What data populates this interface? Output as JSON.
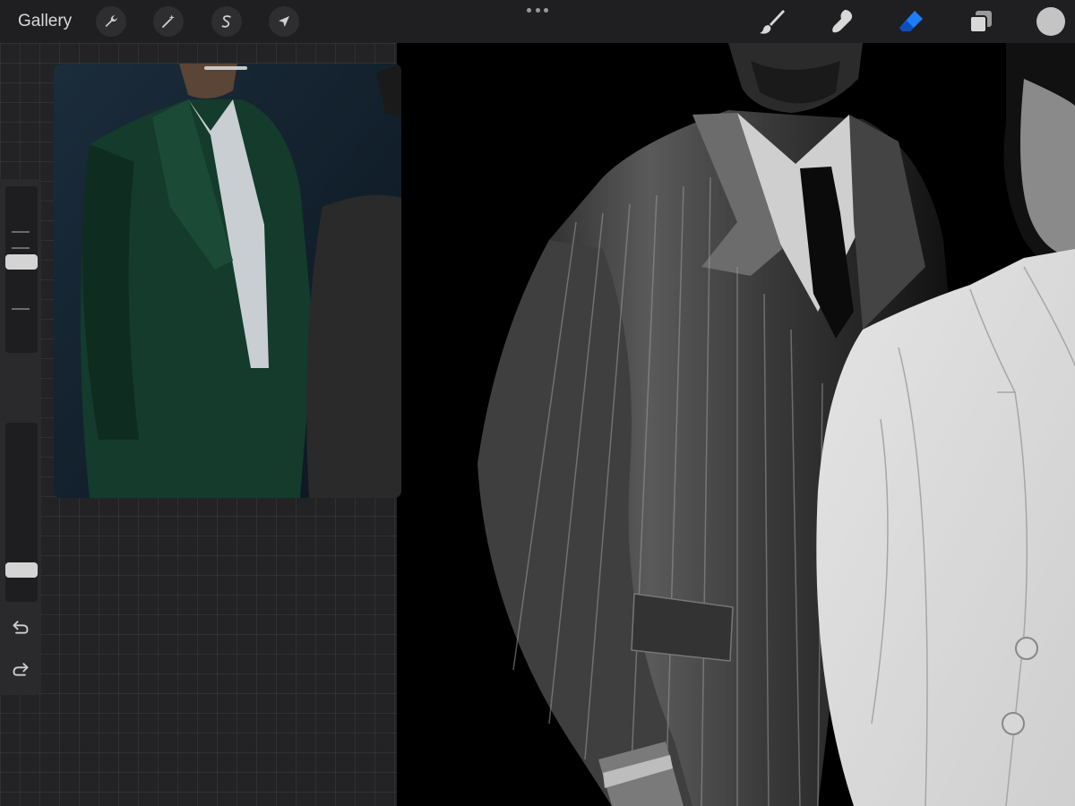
{
  "toolbar": {
    "gallery_label": "Gallery",
    "left_tools": [
      {
        "icon": "wrench-icon",
        "name": "actions-button"
      },
      {
        "icon": "magic-wand-icon",
        "name": "adjustments-button"
      },
      {
        "icon": "selection-s-icon",
        "name": "selection-button"
      },
      {
        "icon": "arrow-cursor-icon",
        "name": "transform-button"
      }
    ],
    "right_tools": [
      {
        "icon": "paintbrush-icon",
        "name": "brush-button"
      },
      {
        "icon": "smudge-icon",
        "name": "smudge-button"
      },
      {
        "icon": "eraser-icon",
        "name": "eraser-button",
        "active": true
      },
      {
        "icon": "layers-icon",
        "name": "layers-button"
      }
    ],
    "active_color": "#c4c4c4",
    "accent_color": "#1e7cff"
  },
  "sidebar": {
    "brush_size_level": 0.55,
    "opacity_level": 0.15,
    "undo_icon": "undo-icon",
    "redo_icon": "redo-icon"
  },
  "reference_window": {
    "visible": true
  }
}
